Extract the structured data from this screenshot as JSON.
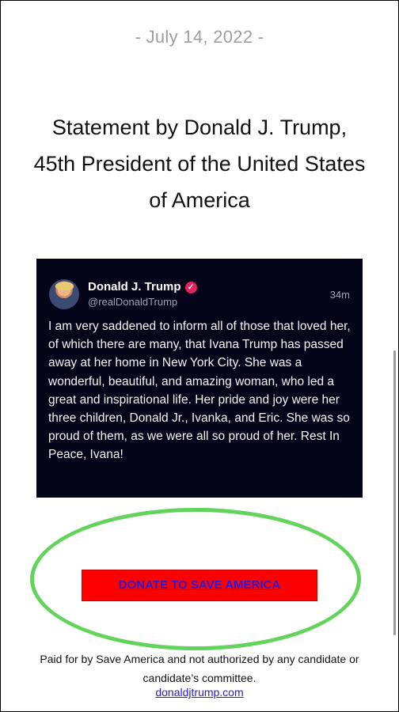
{
  "date": "- July 14, 2022 -",
  "title": "Statement by Donald J. Trump, 45th President of the United States of America",
  "tweet": {
    "name": "Donald J. Trump",
    "handle": "@realDonaldTrump",
    "time": "34m",
    "body": "I am very saddened to inform all of those that loved her, of which there are many, that Ivana Trump has passed away at her home in New York City. She was a wonderful, beautiful, and amazing woman, who led a great and inspirational life. Her pride and joy were her three children, Donald Jr., Ivanka, and Eric. She was so proud of them, as we were all so proud of her. Rest In Peace, Ivana!"
  },
  "donate_label": "DONATE TO SAVE AMERICA",
  "footer": {
    "paid_for": "Paid for by Save America and not authorized by any candidate or candidate’s committee.",
    "site_link": "donaldjtrump.com"
  },
  "colors": {
    "tweet_bg": "#05051a",
    "donate_bg": "#ff0000",
    "link": "#2a1ad9",
    "highlight_circle": "#63d45b"
  }
}
